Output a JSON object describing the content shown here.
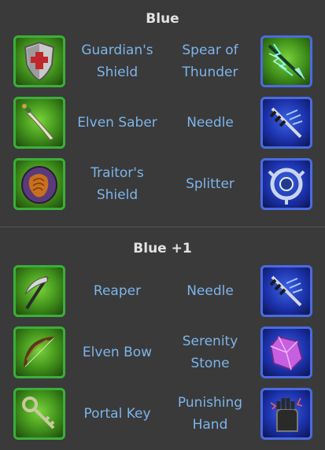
{
  "sections": [
    {
      "title": "Blue",
      "rows": [
        {
          "left": {
            "name": "Guardian's Shield",
            "icon": "guardians-shield-icon"
          },
          "right": {
            "name": "Spear of Thunder",
            "icon": "spear-of-thunder-icon"
          }
        },
        {
          "left": {
            "name": "Elven Saber",
            "icon": "elven-saber-icon"
          },
          "right": {
            "name": "Needle",
            "icon": "needle-icon"
          }
        },
        {
          "left": {
            "name": "Traitor's Shield",
            "icon": "traitors-shield-icon"
          },
          "right": {
            "name": "Splitter",
            "icon": "splitter-icon"
          }
        }
      ]
    },
    {
      "title": "Blue +1",
      "rows": [
        {
          "left": {
            "name": "Reaper",
            "icon": "reaper-icon"
          },
          "right": {
            "name": "Needle",
            "icon": "needle-icon"
          }
        },
        {
          "left": {
            "name": "Elven Bow",
            "icon": "elven-bow-icon"
          },
          "right": {
            "name": "Serenity Stone",
            "icon": "serenity-stone-icon"
          }
        },
        {
          "left": {
            "name": "Portal Key",
            "icon": "portal-key-icon"
          },
          "right": {
            "name": "Punishing Hand",
            "icon": "punishing-hand-icon"
          }
        }
      ]
    }
  ],
  "colors": {
    "background": "#3a3a3a",
    "title": "#e2e2e2",
    "item_label": "#7db4ea",
    "green_frame": "#3cae3c",
    "blue_frame": "#4a6be0"
  }
}
